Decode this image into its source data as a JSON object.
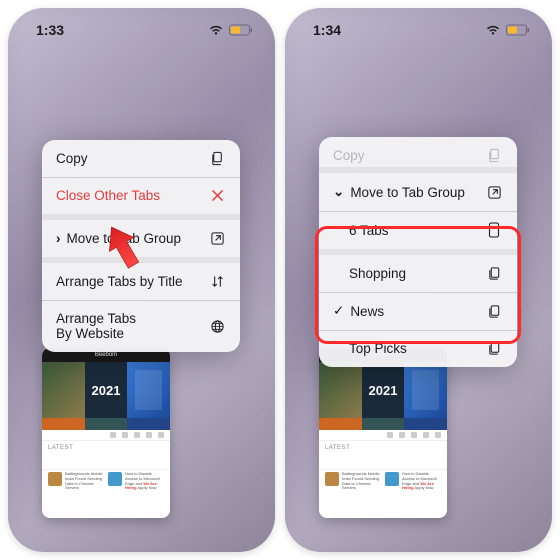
{
  "left": {
    "status": {
      "time": "1:33"
    },
    "menu": {
      "copy": "Copy",
      "close_other": "Close Other Tabs",
      "move_group": "Move to Tab Group",
      "arrange_title": "Arrange Tabs by Title",
      "arrange_site": "Arrange Tabs\nBy Website"
    }
  },
  "right": {
    "status": {
      "time": "1:34"
    },
    "menu": {
      "copy": "Copy",
      "move_group": "Move to Tab Group",
      "tabs_count": "6 Tabs",
      "group1": "Shopping",
      "group2": "News",
      "group3": "Top Picks"
    }
  },
  "thumb": {
    "site": "Beebom",
    "year": "2021",
    "latest": "LATEST",
    "item1": "Battlegrounds Mobile India Found Sending Data to Chinese Servers",
    "item2": "How to Disable Access to Microsoft Edge and",
    "hire": "We Are Hiring",
    "apply": "Apply Now"
  },
  "colors": {
    "destructive": "#e63a3a",
    "highlight": "#ff2a2a",
    "battery": "#f7ba2e"
  }
}
